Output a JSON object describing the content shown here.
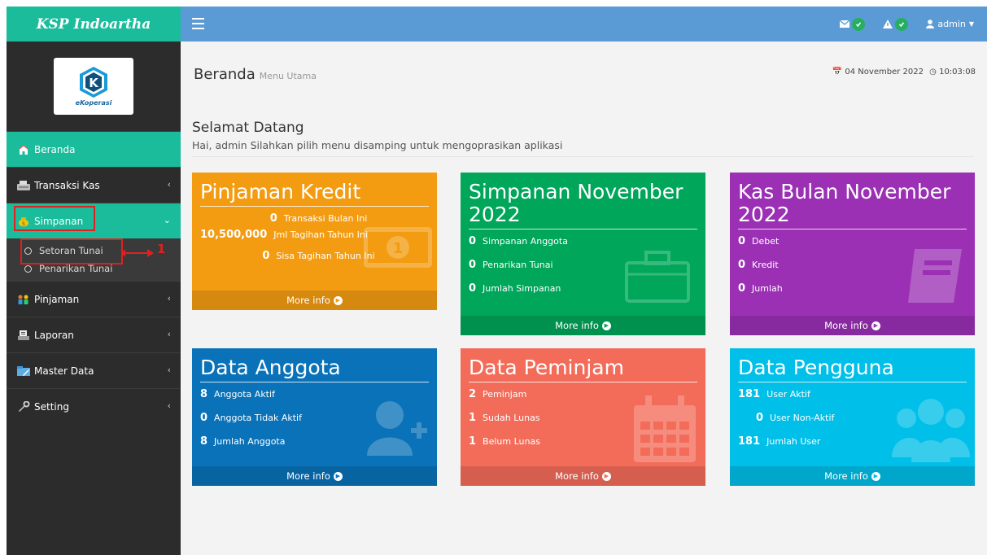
{
  "app": {
    "title": "KSP Indoartha",
    "logo_text": "eKoperasi"
  },
  "sidebar": {
    "items": [
      {
        "label": "Beranda",
        "icon": "home-icon"
      },
      {
        "label": "Transaksi Kas",
        "icon": "cash-register-icon"
      },
      {
        "label": "Simpanan",
        "icon": "money-bag-icon"
      },
      {
        "label": "Pinjaman",
        "icon": "people-money-icon"
      },
      {
        "label": "Laporan",
        "icon": "report-icon"
      },
      {
        "label": "Master Data",
        "icon": "folder-icon"
      },
      {
        "label": "Setting",
        "icon": "wrench-icon"
      }
    ],
    "submenu": [
      {
        "label": "Setoran Tunai"
      },
      {
        "label": "Penarikan Tunai"
      }
    ],
    "annotation_number": "1"
  },
  "topbar": {
    "user": "admin"
  },
  "header": {
    "title": "Beranda",
    "subtitle": "Menu Utama",
    "date": "04 November 2022",
    "time": "10:03:08"
  },
  "welcome": {
    "title": "Selamat Datang",
    "text": "Hai, admin Silahkan pilih menu disamping untuk mengoprasikan aplikasi"
  },
  "cards": [
    {
      "title": "Pinjaman Kredit",
      "color": "#f39c12",
      "rows": [
        {
          "value": "0",
          "label": "Transaksi Bulan Ini"
        },
        {
          "value": "10,500,000",
          "label": "Jml Tagihan Tahun Ini"
        },
        {
          "value": "0",
          "label": "Sisa Tagihan Tahun Ini"
        }
      ],
      "footer": "More info",
      "icon": "money-icon"
    },
    {
      "title": "Simpanan November",
      "title2": "2022",
      "color": "#00a65a",
      "rows": [
        {
          "value": "0",
          "label": "Simpanan Anggota"
        },
        {
          "value": "0",
          "label": "Penarikan Tunai"
        },
        {
          "value": "0",
          "label": "Jumlah Simpanan"
        }
      ],
      "footer": "More info",
      "icon": "briefcase-icon"
    },
    {
      "title": "Kas Bulan November",
      "title2": "2022",
      "color": "#9b30b5",
      "rows": [
        {
          "value": "0",
          "label": "Debet"
        },
        {
          "value": "0",
          "label": "Kredit"
        },
        {
          "value": "0",
          "label": "Jumlah"
        }
      ],
      "footer": "More info",
      "icon": "book-icon"
    },
    {
      "title": "Data Anggota",
      "color": "#0a72b8",
      "rows": [
        {
          "value": "8",
          "label": "Anggota Aktif"
        },
        {
          "value": "0",
          "label": "Anggota Tidak Aktif"
        },
        {
          "value": "8",
          "label": "Jumlah Anggota"
        }
      ],
      "footer": "More info",
      "icon": "user-plus-icon"
    },
    {
      "title": "Data Peminjam",
      "color": "#f36c5a",
      "rows": [
        {
          "value": "2",
          "label": "Peminjam"
        },
        {
          "value": "1",
          "label": "Sudah Lunas"
        },
        {
          "value": "1",
          "label": "Belum Lunas"
        }
      ],
      "footer": "More info",
      "icon": "calendar-icon"
    },
    {
      "title": "Data Pengguna",
      "color": "#00bfe8",
      "rows": [
        {
          "value": "181",
          "label": "User Aktif"
        },
        {
          "value": "0",
          "label": "User Non-Aktif"
        },
        {
          "value": "181",
          "label": "Jumlah User"
        }
      ],
      "footer": "More info",
      "icon": "users-icon"
    }
  ]
}
